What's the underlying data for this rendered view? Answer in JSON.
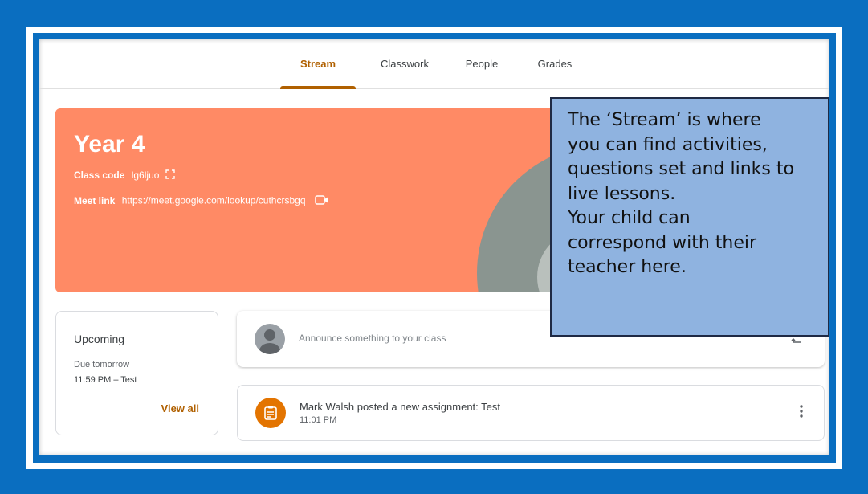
{
  "tabs": [
    {
      "label": "Stream",
      "active": true
    },
    {
      "label": "Classwork",
      "active": false
    },
    {
      "label": "People",
      "active": false
    },
    {
      "label": "Grades",
      "active": false
    }
  ],
  "banner": {
    "title": "Year 4",
    "class_code_label": "Class code",
    "class_code": "lg6ljuo",
    "meet_label": "Meet link",
    "meet_link": "https://meet.google.com/lookup/cuthcrsbgq",
    "color": "#ff8a65"
  },
  "callout": {
    "lines": [
      "The ‘Stream’ is where",
      "you can find activities,",
      "questions set and links to",
      "live lessons.",
      "Your child can",
      "correspond with their",
      "teacher here."
    ]
  },
  "upcoming": {
    "title": "Upcoming",
    "due": "Due tomorrow",
    "item": "11:59 PM – Test",
    "view_all": "View all"
  },
  "announce": {
    "placeholder": "Announce something to your class"
  },
  "post": {
    "title": "Mark Walsh posted a new assignment: Test",
    "time": "11:01 PM"
  },
  "icons": {
    "fullscreen": "fullscreen-icon",
    "video": "video-camera-icon",
    "avatar": "user-avatar-icon",
    "repost": "repost-icon",
    "assignment": "assignment-icon",
    "more": "more-vert-icon"
  },
  "colors": {
    "frame_blue": "#0a6ec0",
    "accent": "#b06000",
    "callout_bg": "#8fb3e0",
    "assignment": "#e37400"
  }
}
